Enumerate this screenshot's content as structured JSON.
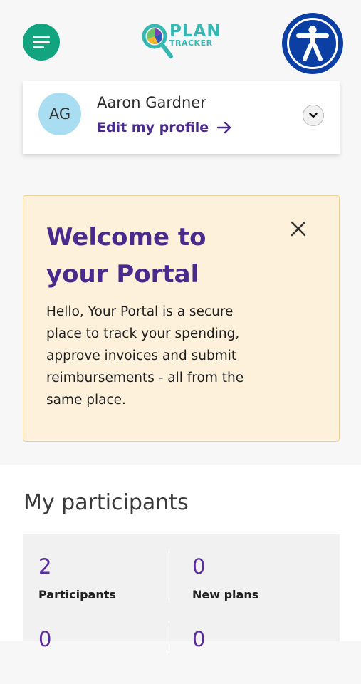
{
  "header": {
    "menu_icon": "hamburger-menu-icon",
    "logo": {
      "line1": "PLAN",
      "line2": "TRACKER"
    },
    "accessibility_icon": "accessibility-person-icon"
  },
  "profile": {
    "initials": "AG",
    "name": "Aaron Gardner",
    "edit_label": "Edit my profile",
    "edit_icon": "arrow-right-icon",
    "expand_icon": "chevron-down-icon"
  },
  "welcome": {
    "title": "Welcome to your Portal",
    "body": "Hello, Your Portal is a secure place to track your spending, approve invoices and submit reimbursements - all from the same place.",
    "close_icon": "close-icon"
  },
  "participants": {
    "heading": "My participants",
    "stats": [
      {
        "value": "2",
        "label": "Participants"
      },
      {
        "value": "0",
        "label": "New plans"
      },
      {
        "value": "0",
        "label": ""
      },
      {
        "value": "0",
        "label": ""
      }
    ]
  },
  "colors": {
    "menu_bg": "#12a37f",
    "accessibility_bg": "#0b3fa3",
    "brand_purple": "#4a2a8c",
    "banner_bg": "#fdf1dc",
    "avatar_bg": "#a9def2",
    "logo_teal": "#35b8b4"
  }
}
